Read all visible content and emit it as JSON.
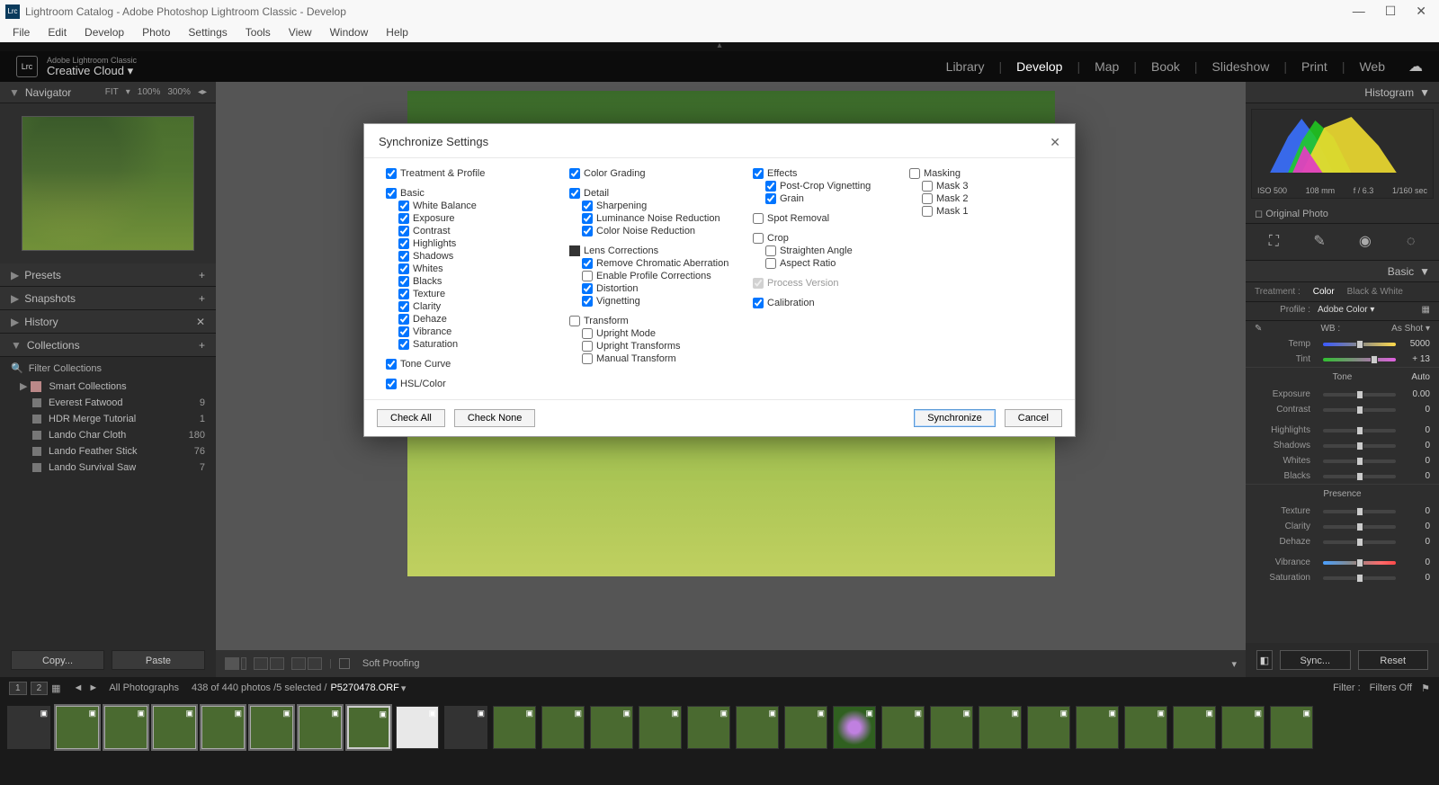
{
  "titlebar": "Lightroom Catalog - Adobe Photoshop Lightroom Classic - Develop",
  "menubar": [
    "File",
    "Edit",
    "Develop",
    "Photo",
    "Settings",
    "Tools",
    "View",
    "Window",
    "Help"
  ],
  "brand": {
    "line1": "Adobe Lightroom Classic",
    "line2": "Creative Cloud"
  },
  "modules": [
    "Library",
    "Develop",
    "Map",
    "Book",
    "Slideshow",
    "Print",
    "Web"
  ],
  "active_module": "Develop",
  "navigator": {
    "title": "Navigator",
    "zoom": [
      "FIT",
      "100%",
      "300%"
    ]
  },
  "left_sections": {
    "presets": "Presets",
    "snapshots": "Snapshots",
    "history": "History",
    "collections": "Collections"
  },
  "filter_collections_label": "Filter Collections",
  "collections": [
    {
      "name": "Smart Collections",
      "count": "",
      "tree": true
    },
    {
      "name": "Everest Fatwood",
      "count": "9"
    },
    {
      "name": "HDR Merge Tutorial",
      "count": "1"
    },
    {
      "name": "Lando Char Cloth",
      "count": "180"
    },
    {
      "name": "Lando Feather Stick",
      "count": "76"
    },
    {
      "name": "Lando Survival Saw",
      "count": "7"
    }
  ],
  "left_buttons": {
    "copy": "Copy...",
    "paste": "Paste"
  },
  "soft_proofing": "Soft Proofing",
  "histogram": {
    "title": "Histogram",
    "iso": "ISO 500",
    "mm": "108 mm",
    "f": "f / 6.3",
    "shutter": "1/160 sec",
    "orig": "Original Photo"
  },
  "basic": {
    "title": "Basic",
    "treatment_label": "Treatment :",
    "color": "Color",
    "bw": "Black & White",
    "profile_label": "Profile :",
    "profile": "Adobe Color",
    "wb_label": "WB :",
    "wb": "As Shot",
    "temp_label": "Temp",
    "temp_val": "5000",
    "tint_label": "Tint",
    "tint_val": "+ 13",
    "tone_label": "Tone",
    "auto": "Auto",
    "exposure": "Exposure",
    "exposure_v": "0.00",
    "contrast": "Contrast",
    "contrast_v": "0",
    "highlights": "Highlights",
    "highlights_v": "0",
    "shadows": "Shadows",
    "shadows_v": "0",
    "whites": "Whites",
    "whites_v": "0",
    "blacks": "Blacks",
    "blacks_v": "0",
    "presence": "Presence",
    "texture": "Texture",
    "texture_v": "0",
    "clarity": "Clarity",
    "clarity_v": "0",
    "dehaze": "Dehaze",
    "dehaze_v": "0",
    "vibrance": "Vibrance",
    "vibrance_v": "0",
    "saturation": "Saturation",
    "saturation_v": "0"
  },
  "right_buttons": {
    "sync": "Sync...",
    "reset": "Reset"
  },
  "filmstrip": {
    "nav1": "1",
    "nav2": "2",
    "all": "All Photographs",
    "count": "438 of 440 photos /5 selected /",
    "file": "P5270478.ORF",
    "filter_label": "Filter :",
    "filter_value": "Filters Off"
  },
  "dialog": {
    "title": "Synchronize Settings",
    "col1": {
      "top": {
        "label": "Treatment & Profile",
        "checked": true
      },
      "basic": {
        "label": "Basic",
        "checked": true,
        "items": [
          {
            "label": "White Balance",
            "checked": true
          },
          {
            "label": "Exposure",
            "checked": true
          },
          {
            "label": "Contrast",
            "checked": true
          },
          {
            "label": "Highlights",
            "checked": true
          },
          {
            "label": "Shadows",
            "checked": true
          },
          {
            "label": "Whites",
            "checked": true
          },
          {
            "label": "Blacks",
            "checked": true
          },
          {
            "label": "Texture",
            "checked": true
          },
          {
            "label": "Clarity",
            "checked": true
          },
          {
            "label": "Dehaze",
            "checked": true
          },
          {
            "label": "Vibrance",
            "checked": true
          },
          {
            "label": "Saturation",
            "checked": true
          }
        ]
      },
      "tone": {
        "label": "Tone Curve",
        "checked": true
      },
      "hsl": {
        "label": "HSL/Color",
        "checked": true
      }
    },
    "col2": {
      "grading": {
        "label": "Color Grading",
        "checked": true
      },
      "detail": {
        "label": "Detail",
        "checked": true,
        "items": [
          {
            "label": "Sharpening",
            "checked": true
          },
          {
            "label": "Luminance Noise Reduction",
            "checked": true
          },
          {
            "label": "Color Noise Reduction",
            "checked": true
          }
        ]
      },
      "lens": {
        "label": "Lens Corrections",
        "indeterminate": true,
        "items": [
          {
            "label": "Remove Chromatic Aberration",
            "checked": true
          },
          {
            "label": "Enable Profile Corrections",
            "checked": false
          },
          {
            "label": "Distortion",
            "checked": true
          },
          {
            "label": "Vignetting",
            "checked": true
          }
        ]
      },
      "transform": {
        "label": "Transform",
        "checked": false,
        "items": [
          {
            "label": "Upright Mode",
            "checked": false
          },
          {
            "label": "Upright Transforms",
            "checked": false
          },
          {
            "label": "Manual Transform",
            "checked": false
          }
        ]
      }
    },
    "col3": {
      "effects": {
        "label": "Effects",
        "checked": true,
        "items": [
          {
            "label": "Post-Crop Vignetting",
            "checked": true
          },
          {
            "label": "Grain",
            "checked": true
          }
        ]
      },
      "spot": {
        "label": "Spot Removal",
        "checked": false
      },
      "crop": {
        "label": "Crop",
        "checked": false,
        "items": [
          {
            "label": "Straighten Angle",
            "checked": false
          },
          {
            "label": "Aspect Ratio",
            "checked": false
          }
        ]
      },
      "process": {
        "label": "Process Version",
        "checked": true,
        "disabled": true
      },
      "calib": {
        "label": "Calibration",
        "checked": true
      }
    },
    "col4": {
      "masking": {
        "label": "Masking",
        "checked": false,
        "items": [
          {
            "label": "Mask 3",
            "checked": false
          },
          {
            "label": "Mask 2",
            "checked": false
          },
          {
            "label": "Mask 1",
            "checked": false
          }
        ]
      }
    },
    "buttons": {
      "check_all": "Check All",
      "check_none": "Check None",
      "sync": "Synchronize",
      "cancel": "Cancel"
    }
  }
}
